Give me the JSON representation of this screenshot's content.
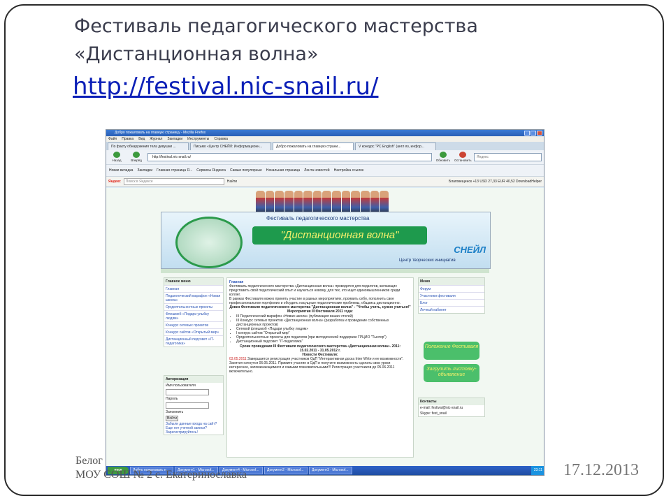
{
  "slide": {
    "title_line1": "Фестиваль педагогического мастерства",
    "title_line2": "«Дистанционная волна»",
    "link": "http://festival.nic-snail.ru/",
    "footer_line1": "Белог",
    "footer_line2": "МОУ СОШ № 2 с. Екатеринославка",
    "date": "17.12.2013"
  },
  "browser": {
    "window_title": "Добро пожаловать на главную страницу - Mozilla Firefox",
    "menu": [
      "Файл",
      "Правка",
      "Вид",
      "Журнал",
      "Закладки",
      "Инструменты",
      "Справка"
    ],
    "tabs": [
      "По факту обнаружения тела девушки ...",
      "Письмо «Центр СНЕЙЛ: Информационн...",
      "Добро пожаловать на главную страни...",
      "V конкурс \"PC English\" (англ яз, инфор..."
    ],
    "nav": {
      "back": "Назад",
      "forward": "Вперёд",
      "refresh": "Обновить",
      "stop": "Остановить"
    },
    "url": "http://festival.nic-snail.ru/",
    "search_placeholder": "Яндекс",
    "bookmarks": [
      "Новая вкладка",
      "Закладки",
      "Главная страница Я...",
      "Сервисы Яндекса",
      "Самые популярные",
      "Начальная страница",
      "Лента новостей",
      "Настройка ссылок"
    ],
    "yandex_bar": {
      "logo": "Яндекс",
      "search_placeholder": "Поиск в Яндексе",
      "find": "Найти",
      "currency": "Благовещенск +13  USD 27,33  EUR 40,52  DownloadHelper"
    }
  },
  "site": {
    "header": "Фестиваль педагогического мастерства",
    "wave": "\"Дистанционная волна\"",
    "center": "Центр творческих инициатив",
    "brand": "СНЕЙЛ",
    "main_menu_title": "Главное меню",
    "main_menu": [
      "Главная",
      "Педагогический марафон «Новая школа»",
      "Оргдеятельностные проекты",
      "Флешмоб «Подари улыбку людям»",
      "Конкурс сетевых проектов",
      "Конкурс сайтов «Открытый мир»",
      "Дистанционный педсовет «IT-педагогика»"
    ],
    "auth_title": "Авторизация",
    "auth_user": "Имя пользователя",
    "auth_pass": "Пароль",
    "auth_remember": "Запомнить",
    "auth_login": "Войти",
    "auth_forgot": "Забыли данные входа на сайт?",
    "auth_register": "Еще нет учетной записи? Зарегистрируйтесь!",
    "right_menu_title": "Меню",
    "right_menu": [
      "Форум",
      "Участники фестиваля",
      "Блог",
      "Личный кабинет"
    ],
    "btn_polozhenie": "Положение Фестиваля",
    "btn_zagruzit": "Загрузить листовку-объявление",
    "contacts_title": "Контакты",
    "contacts_email": "e-mail: festival@nic-snail.ru",
    "contacts_skype": "Skype: fest_snail",
    "main_title": "Главная",
    "main_intro": "Фестиваль педагогического мастерства «Дистанционная волна» проводится для педагогов, желающих представить свой педагогический опыт и научиться новому, для тех, кто ищет единомышленников среди коллег.",
    "main_p2": "В рамках Фестиваля можно принять участие в разных мероприятиях, проявить себя, пополнить свое профессиональное портфолио и обсудить насущные педагогические проблемы, общаясь дистанционно.",
    "motto": "Девиз Фестиваля педагогического мастерства \"Дистанционная волна\" - \"Чтобы учить, нужно учиться!\"",
    "events_title": "Мероприятия III Фестиваля 2011 года:",
    "events": [
      "III Педагогический марафон «Новая школа» (публикация ваших статей)",
      "III Конкурс сетевых проектов «Дистанционная волна» (разработка и проведение собственных дистанционных проектов)",
      "Сетевой флешмоб «Подари улыбку людям»",
      "I конкурс сайтов \"Открытый мир\"",
      "Оргдеятельностные проекты для педагогов (при методической поддержке ГРЦИО \"Тьютор\")",
      "Дистанционный педсовет \"IT-педагогика\""
    ],
    "dates_title": "Сроки проведения III Фестиваля педагогического мастерства «Дистанционная волна». 2011:",
    "dates": "15.02.2011 - 31.05.2012 г.",
    "news_title": "Новости Фестиваля:",
    "news_date": "03.05.2011",
    "news_text": "Завершается регистрация участников ОдП \"Интерактивная доска Inter Write и ее возможности\". Занятия начнутся 06.05.2011. Примите участие в ОдП и получите возможность сделать свои уроки интереснее, запоминающимися и самыми позновательными!!! Регистрация участников до 05.06.2011 включительно."
  },
  "taskbar": {
    "start": "пуск",
    "items": [
      "Добро пожаловать н...",
      "Документ1 - Microsof...",
      "Документ4 - Microsof...",
      "Документ2 - Microsof...",
      "Документ3 - Microsof..."
    ],
    "clock": "23:11"
  }
}
